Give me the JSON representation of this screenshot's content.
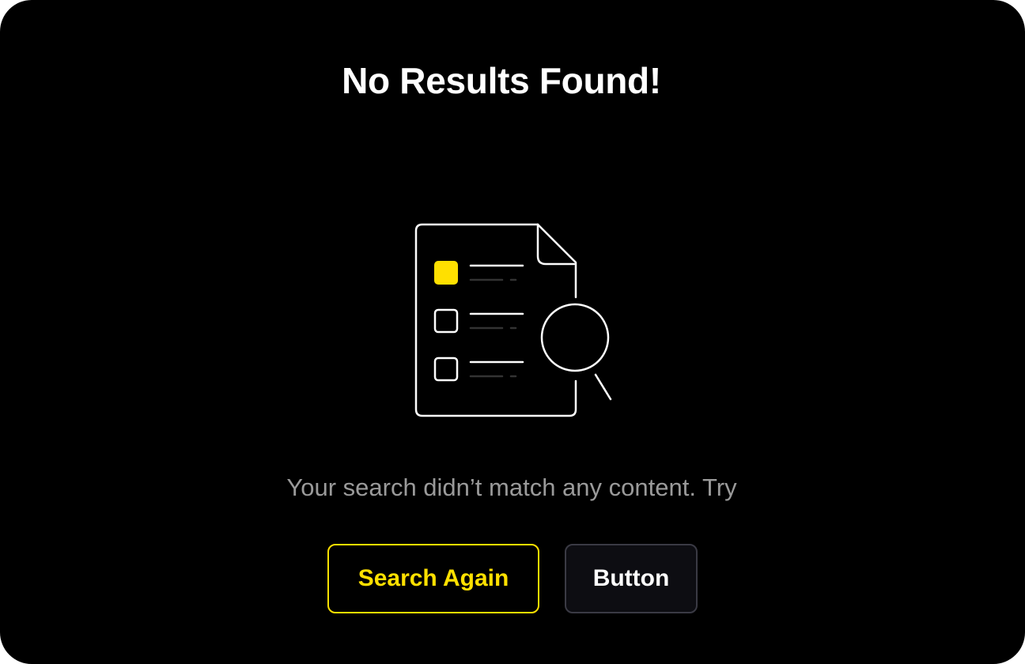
{
  "empty_state": {
    "title": "No Results Found!",
    "message": "Your search didn’t match any content. Try"
  },
  "actions": {
    "primary_label": "Search Again",
    "secondary_label": "Button"
  },
  "illustration": {
    "icon": "document-search-icon",
    "checklist": [
      {
        "checked": true
      },
      {
        "checked": false
      },
      {
        "checked": false
      }
    ]
  },
  "colors": {
    "background": "#000000",
    "accent": "#FFE000",
    "text_primary": "#FFFFFF",
    "text_muted": "#9A9A9A",
    "secondary_button_border": "#3A3A44"
  }
}
